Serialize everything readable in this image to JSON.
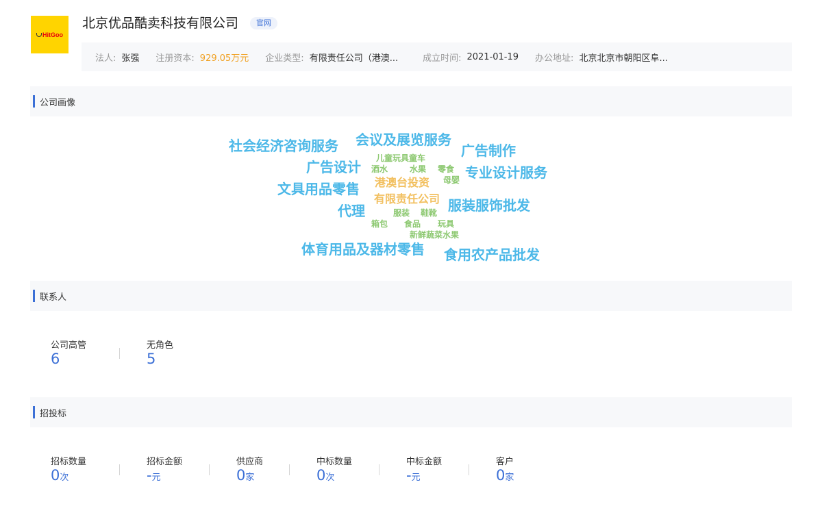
{
  "header": {
    "logo_text": "HitGoo",
    "company_name": "北京优品酷卖科技有限公司",
    "official_badge": "官网",
    "info": [
      {
        "label": "法人:",
        "value": "张强",
        "color": "#333333"
      },
      {
        "label": "注册资本:",
        "value": "929.05万元",
        "color": "#f0a020"
      },
      {
        "label": "企业类型:",
        "value": "有限责任公司（港澳...",
        "color": "#333333"
      },
      {
        "label": "成立时间:",
        "value": "2021-01-19",
        "color": "#333333"
      },
      {
        "label": "办公地址:",
        "value": "北京北京市朝阳区阜...",
        "color": "#333333"
      }
    ]
  },
  "portrait": {
    "title": "公司画像",
    "words": [
      {
        "text": "社会经济咨询服务",
        "color": "#4cb8e8"
      },
      {
        "text": "会议及展览服务",
        "color": "#4cb8e8"
      },
      {
        "text": "广告制作",
        "color": "#4cb8e8"
      },
      {
        "text": "儿童玩具童车",
        "color": "#8cc870"
      },
      {
        "text": "广告设计",
        "color": "#4cb8e8"
      },
      {
        "text": "酒水",
        "color": "#8cc870"
      },
      {
        "text": "水果",
        "color": "#8cc870"
      },
      {
        "text": "零食",
        "color": "#8cc870"
      },
      {
        "text": "专业设计服务",
        "color": "#4cb8e8"
      },
      {
        "text": "母婴",
        "color": "#8cc870"
      },
      {
        "text": "港澳台投资",
        "color": "#f2c060"
      },
      {
        "text": "文具用品零售",
        "color": "#4cb8e8"
      },
      {
        "text": "有限责任公司",
        "color": "#f2c060"
      },
      {
        "text": "代理",
        "color": "#4cb8e8"
      },
      {
        "text": "服装服饰批发",
        "color": "#4cb8e8"
      },
      {
        "text": "服装",
        "color": "#8cc870"
      },
      {
        "text": "鞋靴",
        "color": "#8cc870"
      },
      {
        "text": "箱包",
        "color": "#8cc870"
      },
      {
        "text": "食品",
        "color": "#8cc870"
      },
      {
        "text": "玩具",
        "color": "#8cc870"
      },
      {
        "text": "新鲜蔬菜水果",
        "color": "#8cc870"
      },
      {
        "text": "体育用品及器材零售",
        "color": "#4cb8e8"
      },
      {
        "text": "食用农产品批发",
        "color": "#4cb8e8"
      }
    ]
  },
  "contacts": {
    "title": "联系人",
    "stats": [
      {
        "label": "公司高管",
        "value": "6",
        "unit": ""
      },
      {
        "label": "无角色",
        "value": "5",
        "unit": ""
      }
    ]
  },
  "bidding": {
    "title": "招投标",
    "stats": [
      {
        "label": "招标数量",
        "value": "0",
        "unit": "次"
      },
      {
        "label": "招标金额",
        "value": "-",
        "unit": "元"
      },
      {
        "label": "供应商",
        "value": "0",
        "unit": "家"
      },
      {
        "label": "中标数量",
        "value": "0",
        "unit": "次"
      },
      {
        "label": "中标金额",
        "value": "-",
        "unit": "元"
      },
      {
        "label": "客户",
        "value": "0",
        "unit": "家"
      }
    ]
  }
}
